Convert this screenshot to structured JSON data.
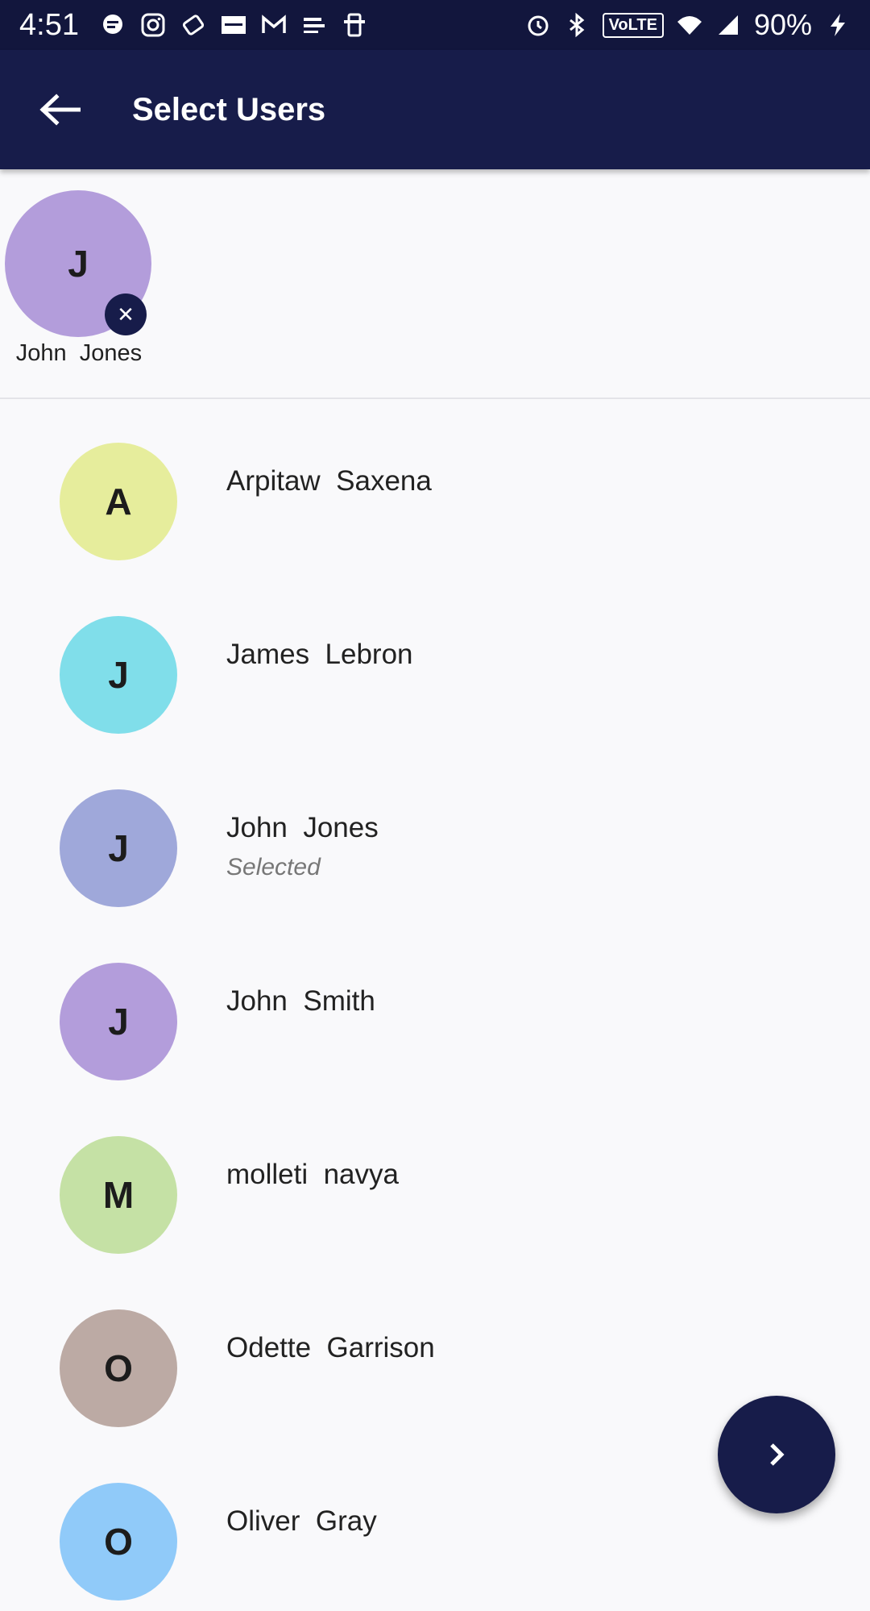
{
  "status_bar": {
    "time": "4:51",
    "notification_icons": [
      "messaging-icon",
      "instagram-icon",
      "ticket-icon",
      "zomato-icon",
      "gmail-icon",
      "livelaw-icon",
      "phone-icon"
    ],
    "volte": "VoLTE",
    "battery": "90%"
  },
  "app_bar": {
    "title": "Select Users",
    "color": "#171c4a"
  },
  "selected_users": [
    {
      "initial": "J",
      "name": "John  Jones",
      "color": "#b39ddb"
    }
  ],
  "users": [
    {
      "initial": "A",
      "name": "Arpitaw  Saxena",
      "color": "#e6ed9c",
      "subtitle": ""
    },
    {
      "initial": "J",
      "name": "James  Lebron",
      "color": "#80deea",
      "subtitle": ""
    },
    {
      "initial": "J",
      "name": "John  Jones",
      "color": "#9fa8da",
      "subtitle": "Selected"
    },
    {
      "initial": "J",
      "name": "John  Smith",
      "color": "#b39ddb",
      "subtitle": ""
    },
    {
      "initial": "M",
      "name": "molleti  navya",
      "color": "#c5e1a5",
      "subtitle": ""
    },
    {
      "initial": "O",
      "name": "Odette  Garrison",
      "color": "#bcaaa4",
      "subtitle": ""
    },
    {
      "initial": "O",
      "name": "Oliver  Gray",
      "color": "#90caf9",
      "subtitle": ""
    }
  ],
  "fab": {
    "icon": "chevron-right-icon"
  }
}
